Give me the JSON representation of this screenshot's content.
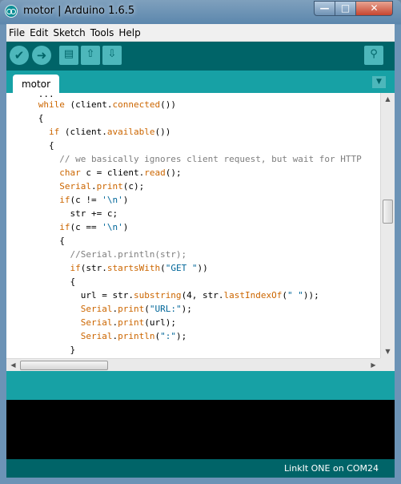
{
  "window": {
    "title": "motor | Arduino 1.6.5",
    "minimize_glyph": "—",
    "maximize_glyph": "□",
    "close_glyph": "✕"
  },
  "menu": {
    "items": [
      "File",
      "Edit",
      "Sketch",
      "Tools",
      "Help"
    ]
  },
  "toolbar": {
    "verify_glyph": "✔",
    "upload_glyph": "➜",
    "new_glyph": "▤",
    "open_glyph": "⇧",
    "save_glyph": "⇩",
    "serial_monitor_glyph": "⚲"
  },
  "tabs": {
    "active": "motor",
    "menu_glyph": "▼"
  },
  "editor": {
    "lines": [
      "      while (client.connected())",
      "      {",
      "        if (client.available())",
      "        {",
      "          // we basically ignores client request, but wait for HTTP",
      "          char c = client.read();",
      "          Serial.print(c);",
      "          if(c != '\\n')",
      "            str += c;",
      "          if(c == '\\n')",
      "          {",
      "            //Serial.println(str);",
      "            if(str.startsWith(\"GET \"))",
      "            {",
      "              url = str.substring(4, str.lastIndexOf(\" \"));",
      "              Serial.print(\"URL:\");",
      "              Serial.print(url);",
      "              Serial.println(\":\");",
      "            }"
    ]
  },
  "scrollbars": {
    "up_glyph": "▲",
    "down_glyph": "▼",
    "left_glyph": "◀",
    "right_glyph": "▶"
  },
  "status": {
    "board_port": "LinkIt ONE on COM24"
  },
  "colors": {
    "toolbar": "#006468",
    "tabbar": "#17a1a5",
    "button": "#4db7bb",
    "keyword": "#cc6600",
    "comment": "#7e7e7e",
    "string": "#006699"
  }
}
